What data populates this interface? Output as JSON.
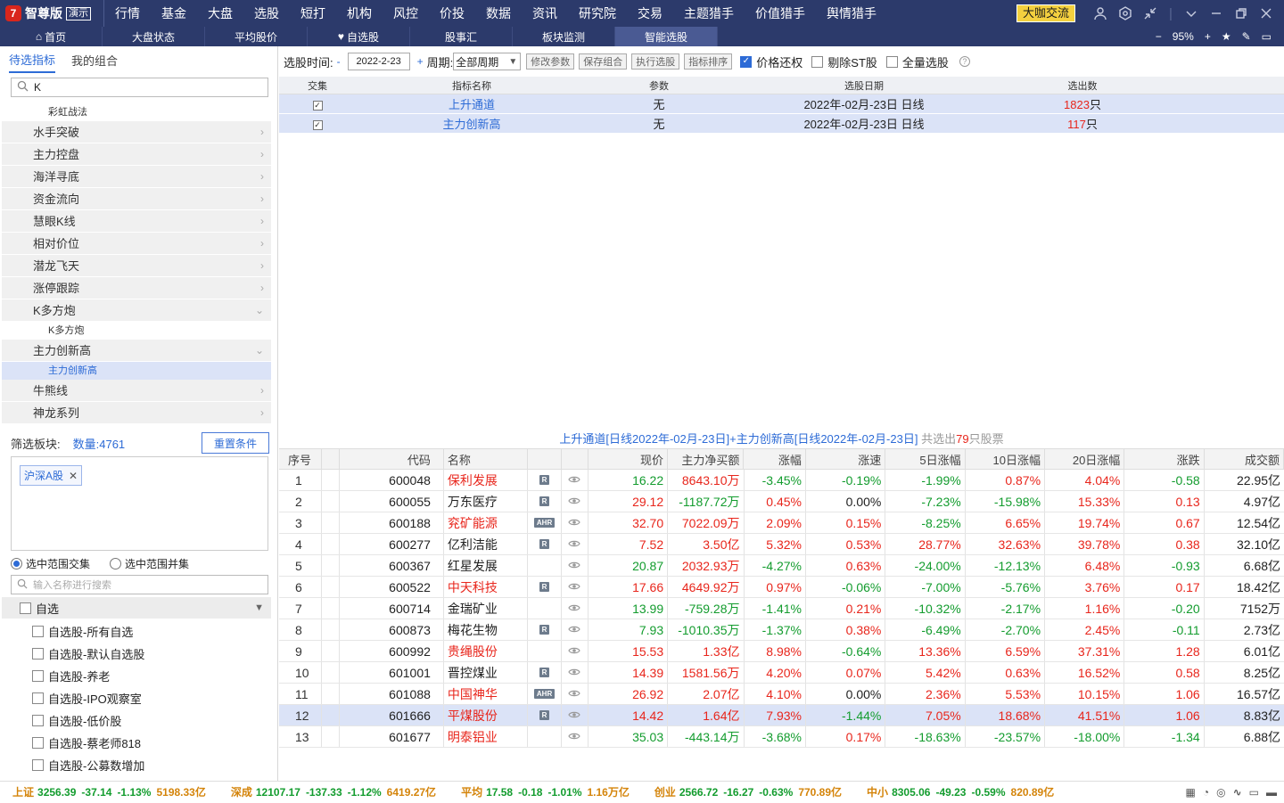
{
  "app": {
    "logo_mark": "7",
    "name": "智尊版",
    "tag": "演示"
  },
  "menu": [
    {
      "label": "行情"
    },
    {
      "label": "基金"
    },
    {
      "label": "大盘"
    },
    {
      "label": "选股"
    },
    {
      "label": "短打"
    },
    {
      "label": "机构"
    },
    {
      "label": "风控"
    },
    {
      "label": "价投"
    },
    {
      "label": "数据"
    },
    {
      "label": "资讯"
    },
    {
      "label": "研究院"
    },
    {
      "label": "交易",
      "dot": true
    },
    {
      "label": "主题猎手"
    },
    {
      "label": "价值猎手"
    },
    {
      "label": "舆情猎手"
    }
  ],
  "topright": {
    "community_label": "大咖交流"
  },
  "tabs": [
    {
      "label": "首页",
      "icon": "home-icon"
    },
    {
      "label": "大盘状态"
    },
    {
      "label": "平均股价"
    },
    {
      "label": "自选股",
      "icon": "heart-icon"
    },
    {
      "label": "股事汇"
    },
    {
      "label": "板块监测"
    },
    {
      "label": "智能选股",
      "active": true
    }
  ],
  "zoom": {
    "minus": "−",
    "value": "95%",
    "plus": "+"
  },
  "left": {
    "tabs": [
      "待选指标",
      "我的组合"
    ],
    "search_value": "K",
    "indicators": [
      {
        "label": "彩虹战法",
        "sub": true
      },
      {
        "label": "水手突破"
      },
      {
        "label": "主力控盘"
      },
      {
        "label": "海洋寻底"
      },
      {
        "label": "资金流向"
      },
      {
        "label": "慧眼K线"
      },
      {
        "label": "相对价位"
      },
      {
        "label": "潜龙飞天"
      },
      {
        "label": "涨停跟踪"
      },
      {
        "label": "K多方炮",
        "open": true
      },
      {
        "label": "K多方炮",
        "sub": true
      },
      {
        "label": "主力创新高",
        "open": true
      },
      {
        "label": "主力创新高",
        "sub": true,
        "selected": true
      },
      {
        "label": "牛熊线"
      },
      {
        "label": "神龙系列"
      }
    ],
    "filter_label": "筛选板块:",
    "filter_count": "数量:4761",
    "reset_label": "重置条件",
    "selected_tag": "沪深A股",
    "radio_intersect": "选中范围交集",
    "radio_union": "选中范围并集",
    "search2_placeholder": "输入名称进行搜索",
    "group_label": "自选",
    "group_items": [
      "自选股-所有自选",
      "自选股-默认自选股",
      "自选股-养老",
      "自选股-IPO观察室",
      "自选股-低价股",
      "自选股-蔡老师818",
      "自选股-公募数增加"
    ]
  },
  "toolbar": {
    "time_label": "选股时间:",
    "date_value": "2022-2-23",
    "period_label": "周期:",
    "period_value": "全部周期",
    "buttons": [
      "修改参数",
      "保存组合",
      "执行选股",
      "指标排序"
    ],
    "chk_adjust": "价格还权",
    "chk_st": "剔除ST股",
    "chk_all": "全量选股"
  },
  "indicator_table": {
    "headers": [
      "交集",
      "指标名称",
      "参数",
      "选股日期",
      "选出数"
    ],
    "rows": [
      {
        "name": "上升通道",
        "param": "无",
        "date": "2022年-02月-23日 日线",
        "count": "1823",
        "unit": "只"
      },
      {
        "name": "主力创新高",
        "param": "无",
        "date": "2022年-02月-23日 日线",
        "count": "117",
        "unit": "只"
      }
    ]
  },
  "summary": {
    "text": "上升通道[日线2022年-02月-23日]+主力创新高[日线2022年-02月-23日]",
    "prefix": "共选出",
    "count": "79",
    "suffix": "只股票"
  },
  "results": {
    "headers": [
      "序号",
      "",
      "代码",
      "名称",
      "",
      "",
      "现价",
      "主力净买额",
      "涨幅",
      "涨速",
      "5日涨幅",
      "10日涨幅",
      "20日涨幅",
      "涨跌",
      "成交额"
    ],
    "rows": [
      {
        "seq": "1",
        "code": "600048",
        "name": "保利发展",
        "name_color": "red",
        "tag": "R",
        "price": "16.22",
        "flow": "8643.10万",
        "pct": "-3.45%",
        "speed": "-0.19%",
        "d5": "-1.99%",
        "d10": "0.87%",
        "d20": "4.04%",
        "chg": "-0.58",
        "amt": "22.95亿"
      },
      {
        "seq": "2",
        "code": "600055",
        "name": "万东医疗",
        "name_color": "black",
        "tag": "R",
        "price": "29.12",
        "flow": "-1187.72万",
        "pct": "0.45%",
        "speed": "0.00%",
        "d5": "-7.23%",
        "d10": "-15.98%",
        "d20": "15.33%",
        "chg": "0.13",
        "amt": "4.97亿"
      },
      {
        "seq": "3",
        "code": "600188",
        "name": "兖矿能源",
        "name_color": "red",
        "tag": "AHR",
        "price": "32.70",
        "flow": "7022.09万",
        "pct": "2.09%",
        "speed": "0.15%",
        "d5": "-8.25%",
        "d10": "6.65%",
        "d20": "19.74%",
        "chg": "0.67",
        "amt": "12.54亿"
      },
      {
        "seq": "4",
        "code": "600277",
        "name": "亿利洁能",
        "name_color": "black",
        "tag": "R",
        "price": "7.52",
        "flow": "3.50亿",
        "pct": "5.32%",
        "speed": "0.53%",
        "d5": "28.77%",
        "d10": "32.63%",
        "d20": "39.78%",
        "chg": "0.38",
        "amt": "32.10亿"
      },
      {
        "seq": "5",
        "code": "600367",
        "name": "红星发展",
        "name_color": "black",
        "tag": "",
        "price": "20.87",
        "flow": "2032.93万",
        "pct": "-4.27%",
        "speed": "0.63%",
        "d5": "-24.00%",
        "d10": "-12.13%",
        "d20": "6.48%",
        "chg": "-0.93",
        "amt": "6.68亿"
      },
      {
        "seq": "6",
        "code": "600522",
        "name": "中天科技",
        "name_color": "red",
        "tag": "R",
        "price": "17.66",
        "flow": "4649.92万",
        "pct": "0.97%",
        "speed": "-0.06%",
        "d5": "-7.00%",
        "d10": "-5.76%",
        "d20": "3.76%",
        "chg": "0.17",
        "amt": "18.42亿"
      },
      {
        "seq": "7",
        "code": "600714",
        "name": "金瑞矿业",
        "name_color": "black",
        "tag": "",
        "price": "13.99",
        "flow": "-759.28万",
        "pct": "-1.41%",
        "speed": "0.21%",
        "d5": "-10.32%",
        "d10": "-2.17%",
        "d20": "1.16%",
        "chg": "-0.20",
        "amt": "7152万"
      },
      {
        "seq": "8",
        "code": "600873",
        "name": "梅花生物",
        "name_color": "black",
        "tag": "R",
        "price": "7.93",
        "flow": "-1010.35万",
        "pct": "-1.37%",
        "speed": "0.38%",
        "d5": "-6.49%",
        "d10": "-2.70%",
        "d20": "2.45%",
        "chg": "-0.11",
        "amt": "2.73亿"
      },
      {
        "seq": "9",
        "code": "600992",
        "name": "贵绳股份",
        "name_color": "red",
        "tag": "",
        "price": "15.53",
        "flow": "1.33亿",
        "pct": "8.98%",
        "speed": "-0.64%",
        "d5": "13.36%",
        "d10": "6.59%",
        "d20": "37.31%",
        "chg": "1.28",
        "amt": "6.01亿"
      },
      {
        "seq": "10",
        "code": "601001",
        "name": "晋控煤业",
        "name_color": "black",
        "tag": "R",
        "price": "14.39",
        "flow": "1581.56万",
        "pct": "4.20%",
        "speed": "0.07%",
        "d5": "5.42%",
        "d10": "0.63%",
        "d20": "16.52%",
        "chg": "0.58",
        "amt": "8.25亿"
      },
      {
        "seq": "11",
        "code": "601088",
        "name": "中国神华",
        "name_color": "red",
        "tag": "AHR",
        "price": "26.92",
        "flow": "2.07亿",
        "pct": "4.10%",
        "speed": "0.00%",
        "d5": "2.36%",
        "d10": "5.53%",
        "d20": "10.15%",
        "chg": "1.06",
        "amt": "16.57亿"
      },
      {
        "seq": "12",
        "code": "601666",
        "name": "平煤股份",
        "name_color": "red",
        "tag": "R",
        "price": "14.42",
        "flow": "1.64亿",
        "pct": "7.93%",
        "speed": "-1.44%",
        "d5": "7.05%",
        "d10": "18.68%",
        "d20": "41.51%",
        "chg": "1.06",
        "amt": "8.83亿",
        "highlight": true
      },
      {
        "seq": "13",
        "code": "601677",
        "name": "明泰铝业",
        "name_color": "red",
        "tag": "",
        "price": "35.03",
        "flow": "-443.14万",
        "pct": "-3.68%",
        "speed": "0.17%",
        "d5": "-18.63%",
        "d10": "-23.57%",
        "d20": "-18.00%",
        "chg": "-1.34",
        "amt": "6.88亿"
      }
    ]
  },
  "status": [
    {
      "name": "上证",
      "value": "3256.39",
      "chg": "-37.14",
      "pct": "-1.13%",
      "amt": "5198.33亿",
      "color": "green"
    },
    {
      "name": "深成",
      "value": "12107.17",
      "chg": "-137.33",
      "pct": "-1.12%",
      "amt": "6419.27亿",
      "color": "green"
    },
    {
      "name": "平均",
      "value": "17.58",
      "chg": "-0.18",
      "pct": "-1.01%",
      "amt": "1.16万亿",
      "color": "green"
    },
    {
      "name": "创业",
      "value": "2566.72",
      "chg": "-16.27",
      "pct": "-0.63%",
      "amt": "770.89亿",
      "color": "green"
    },
    {
      "name": "中小",
      "value": "8305.06",
      "chg": "-49.23",
      "pct": "-0.59%",
      "amt": "820.89亿",
      "color": "green"
    }
  ],
  "colors": {
    "up": "#e8261c",
    "down": "#139c2e",
    "accent": "#2d6bd6",
    "nav_bg": "#2c3a6b"
  }
}
